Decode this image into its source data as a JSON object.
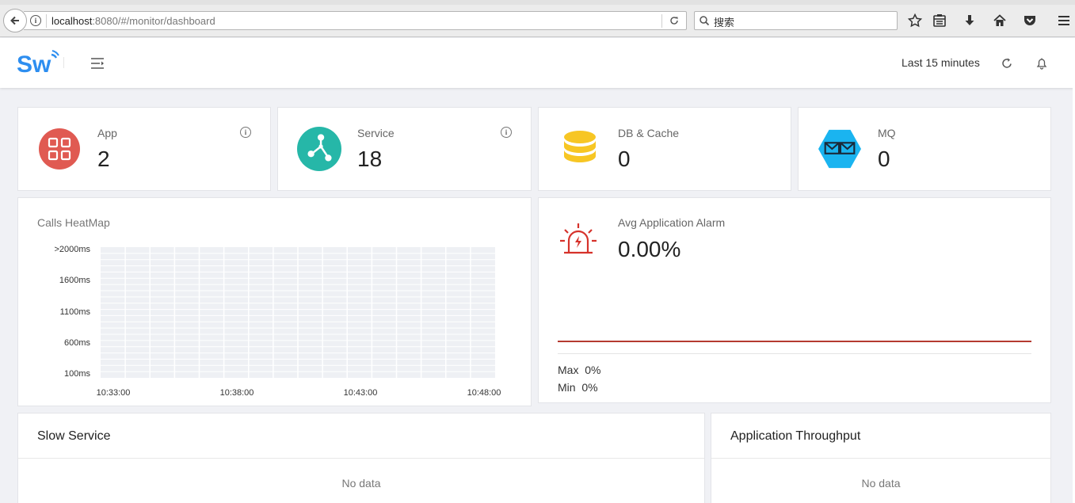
{
  "browser": {
    "url_host": "localhost",
    "url_rest": ":8080/#/monitor/dashboard",
    "search_placeholder": "搜索"
  },
  "header": {
    "time_range": "Last 15 minutes"
  },
  "stats": [
    {
      "label": "App",
      "value": "2",
      "icon": "app-grid-icon",
      "color": "#e05a52"
    },
    {
      "label": "Service",
      "value": "18",
      "icon": "service-share-icon",
      "color": "#26b7a8"
    },
    {
      "label": "DB & Cache",
      "value": "0",
      "icon": "database-icon",
      "color": "#f7c624"
    },
    {
      "label": "MQ",
      "value": "0",
      "icon": "mq-envelope-icon",
      "color": "#1ab4f0"
    }
  ],
  "heatmap": {
    "title": "Calls HeatMap",
    "y_labels": [
      ">2000ms",
      "1600ms",
      "1100ms",
      "600ms",
      "100ms"
    ],
    "x_labels": [
      "10:33:00",
      "10:38:00",
      "10:43:00",
      "10:48:00"
    ]
  },
  "alarm": {
    "label": "Avg Application Alarm",
    "value": "0.00%",
    "max_label": "Max",
    "max_value": "0%",
    "min_label": "Min",
    "min_value": "0%",
    "line_color": "#b53a30"
  },
  "slow_service": {
    "title": "Slow Service",
    "empty": "No data"
  },
  "throughput": {
    "title": "Application Throughput",
    "empty": "No data"
  }
}
